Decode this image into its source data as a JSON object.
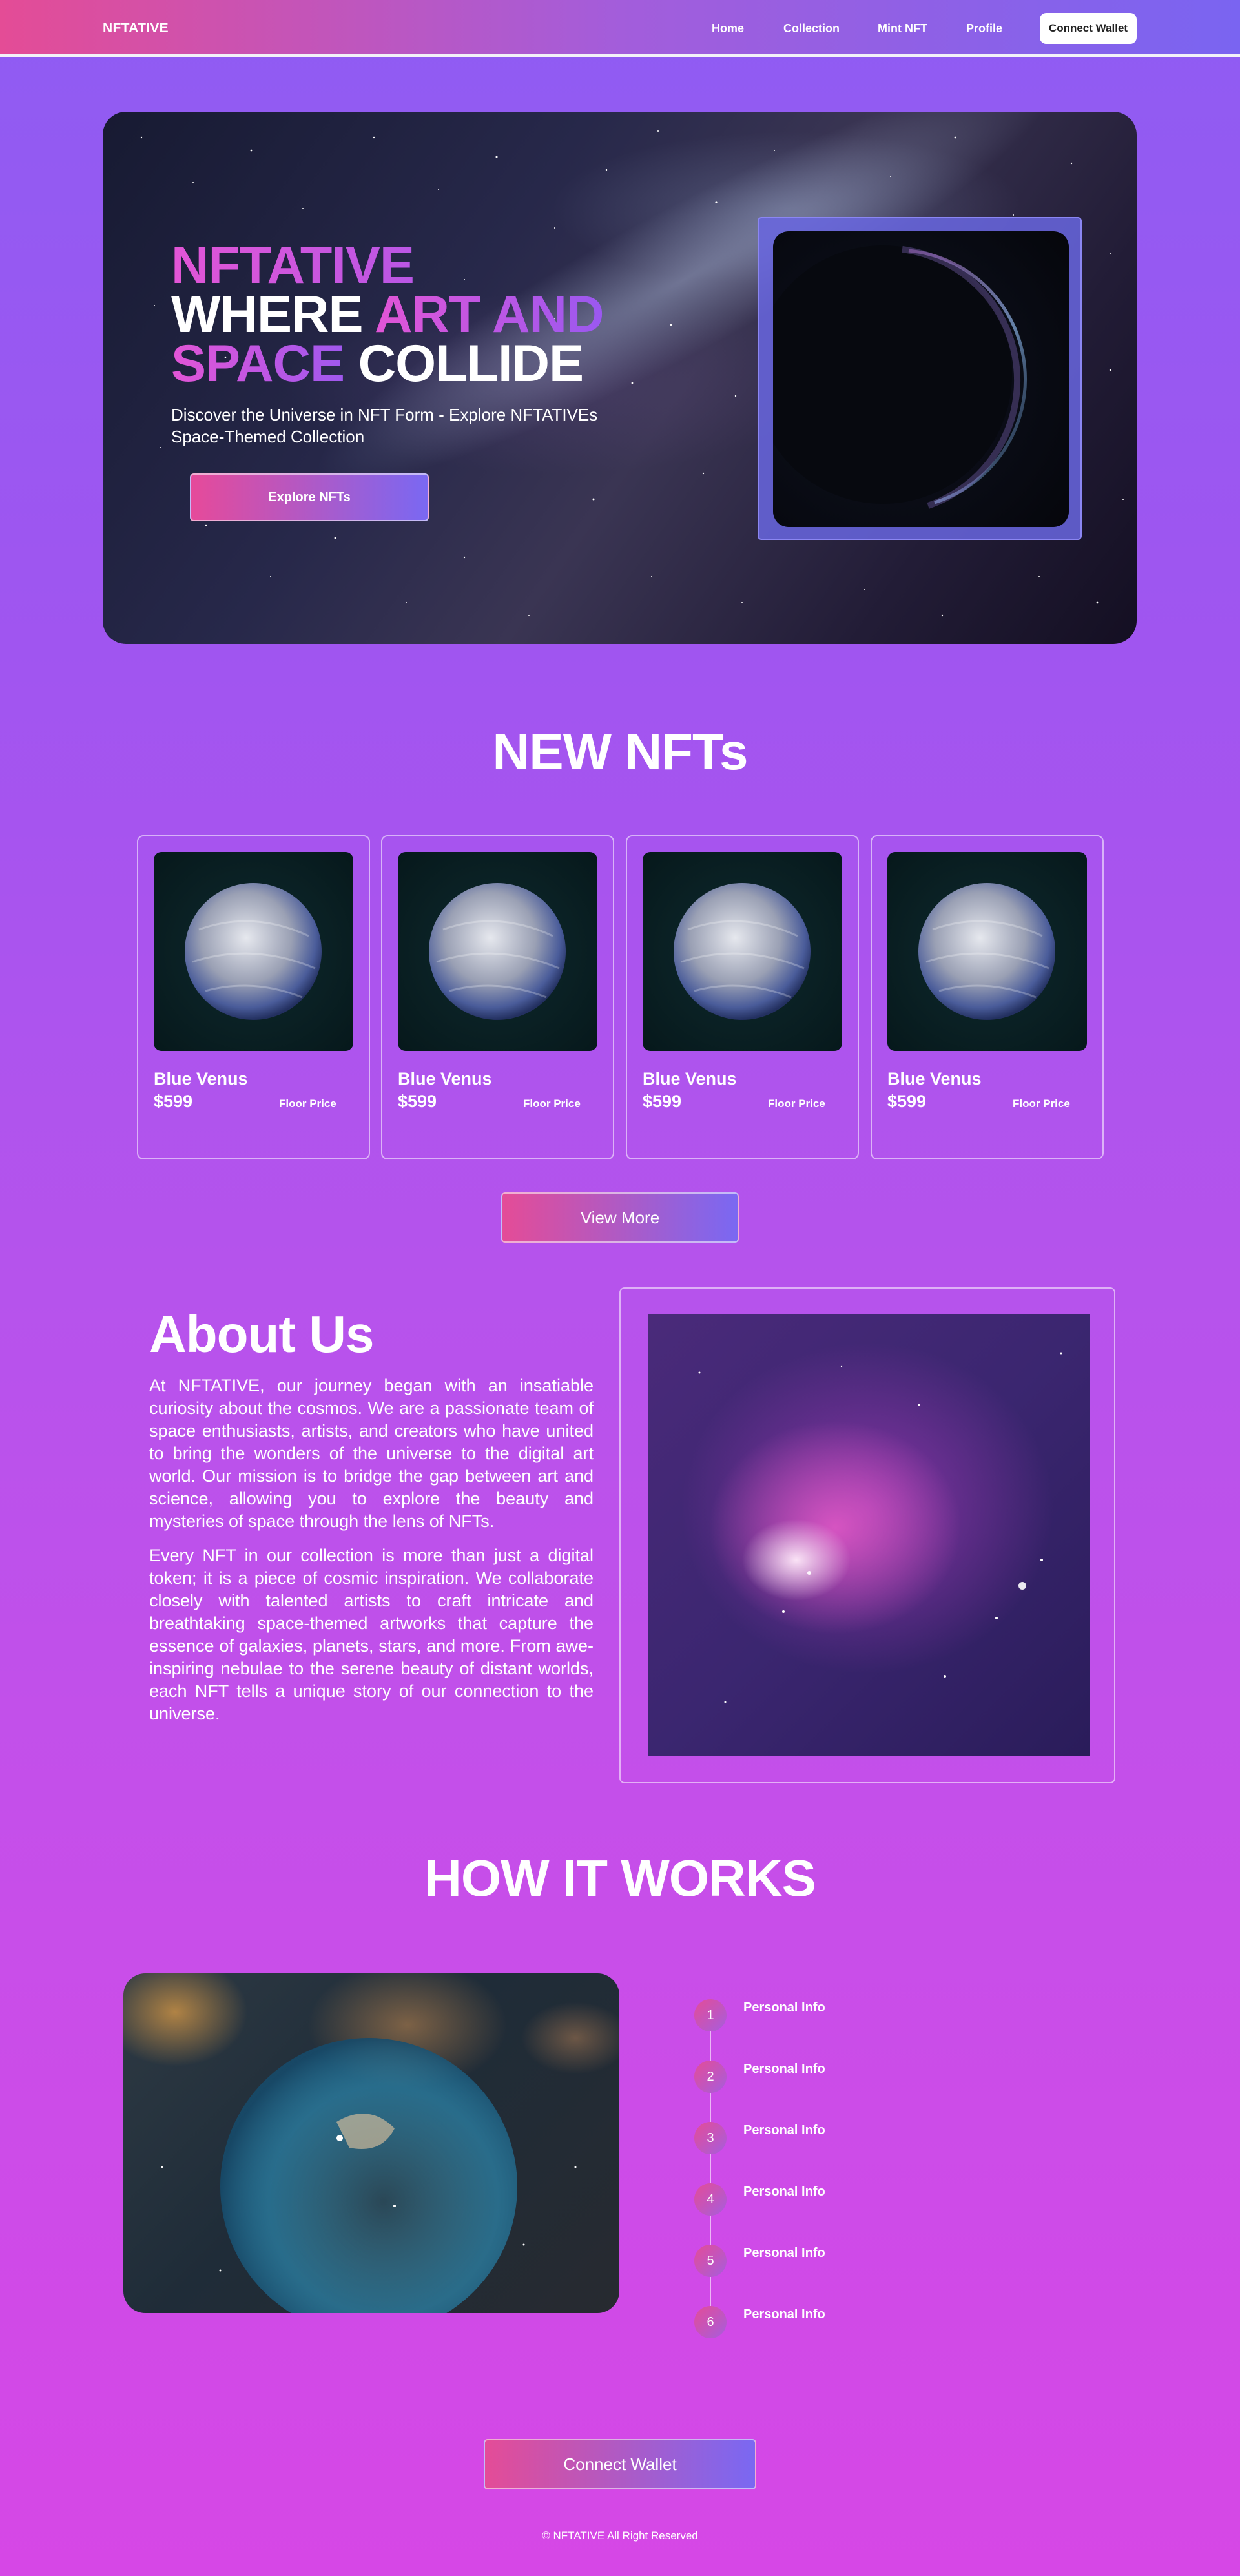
{
  "nav": {
    "brand": "NFTATIVE",
    "links": [
      "Home",
      "Collection",
      "Mint NFT",
      "Profile"
    ],
    "wallet_label": "Connect Wallet"
  },
  "hero": {
    "title_brand": "NFTATIVE",
    "title_where": "WHERE ",
    "title_art": "ART AND",
    "title_space": "SPACE ",
    "title_collide": "COLLIDE",
    "subtitle": "Discover the Universe in NFT Form - Explore NFTATIVEs Space-Themed Collection",
    "cta_label": "Explore NFTs"
  },
  "new_nfts": {
    "title": "NEW NFTs",
    "cards": [
      {
        "name": "Blue Venus",
        "price": "$599",
        "floor_label": "Floor Price"
      },
      {
        "name": "Blue Venus",
        "price": "$599",
        "floor_label": "Floor Price"
      },
      {
        "name": "Blue Venus",
        "price": "$599",
        "floor_label": "Floor Price"
      },
      {
        "name": "Blue Venus",
        "price": "$599",
        "floor_label": "Floor Price"
      }
    ],
    "view_more_label": "View More"
  },
  "about": {
    "title": "About Us",
    "p1": "At NFTATIVE, our journey began with an insatiable curiosity about the cosmos. We are a passionate team of space enthusiasts, artists, and creators who have united to bring the wonders of the universe to the digital art world. Our mission is to bridge the gap between art and science, allowing you to explore the beauty and mysteries of space through the lens of NFTs.",
    "p2": "Every NFT in our collection is more than just a digital token; it is a piece of cosmic inspiration. We collaborate closely with talented artists to craft intricate and breathtaking space-themed artworks that capture the essence of galaxies, planets, stars, and more. From awe-inspiring nebulae to the serene beauty of distant worlds, each NFT tells a unique story of our connection to the universe."
  },
  "how": {
    "title": "HOW IT WORKS",
    "steps": [
      {
        "num": "1",
        "label": "Personal Info"
      },
      {
        "num": "2",
        "label": "Personal Info"
      },
      {
        "num": "3",
        "label": "Personal Info"
      },
      {
        "num": "4",
        "label": "Personal Info"
      },
      {
        "num": "5",
        "label": "Personal Info"
      },
      {
        "num": "6",
        "label": "Personal Info"
      }
    ]
  },
  "connect_wallet_label": "Connect Wallet",
  "footer": "© NFTATIVE All Right Reserved"
}
